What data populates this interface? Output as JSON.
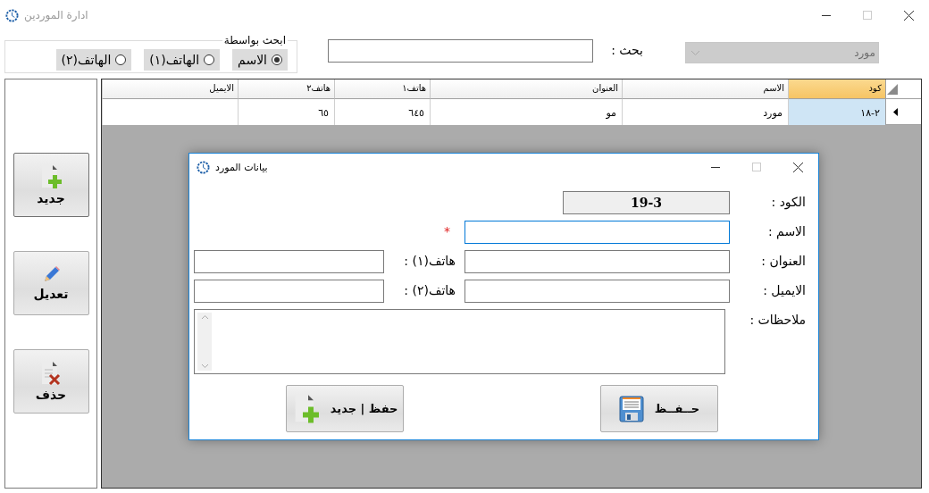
{
  "window": {
    "title": "ادارة الموردين"
  },
  "search_by": {
    "title": "ابحث بواسطة",
    "options": [
      {
        "label": "الاسم",
        "selected": true
      },
      {
        "label": "الهاتف(١)",
        "selected": false
      },
      {
        "label": "الهاتف(٢)",
        "selected": false
      }
    ]
  },
  "search": {
    "label": "بحث :"
  },
  "type_combo": {
    "value": "مورد",
    "disabled": true
  },
  "side_buttons": [
    {
      "label": "جديد",
      "kind": "new"
    },
    {
      "label": "تعديل",
      "kind": "edit"
    },
    {
      "label": "حذف",
      "kind": "delete"
    }
  ],
  "table": {
    "columns": [
      {
        "label": "كود",
        "sorted": true
      },
      {
        "label": "الاسم",
        "sorted": false
      },
      {
        "label": "العنوان",
        "sorted": false
      },
      {
        "label": "هاتف١",
        "sorted": false
      },
      {
        "label": "هاتف٢",
        "sorted": false
      },
      {
        "label": "الايميل",
        "sorted": false
      }
    ],
    "rows": [
      {
        "selected": true,
        "cells": [
          "٢-١٨",
          "مورد",
          "مو",
          "٦٤٥",
          "٦٥",
          ""
        ]
      }
    ]
  },
  "dialog": {
    "title": "بيانات المورد",
    "code": {
      "label": "الكود :",
      "value": "19-3"
    },
    "name": {
      "label": "الاسم :",
      "required_mark": "*",
      "focused": true
    },
    "address": {
      "label": "العنوان :"
    },
    "email": {
      "label": "الايميل :"
    },
    "phone1": {
      "label": "هاتف(١) :"
    },
    "phone2": {
      "label": "هاتف(٢) :"
    },
    "notes": {
      "label": "ملاحظات :"
    },
    "buttons": [
      {
        "label": "حــفــظ",
        "kind": "save"
      },
      {
        "label": "حفظ | جديد",
        "kind": "save_new"
      }
    ]
  }
}
